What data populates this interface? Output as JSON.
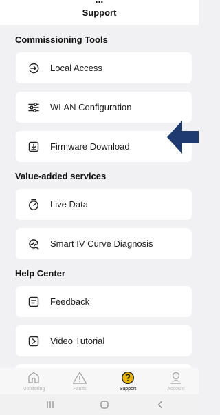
{
  "header": {
    "cut_title": "...",
    "title": "Support"
  },
  "sections": [
    {
      "title": "Commissioning Tools",
      "items": [
        {
          "label": "Local Access",
          "icon": "local-access-icon"
        },
        {
          "label": "WLAN Configuration",
          "icon": "sliders-icon"
        },
        {
          "label": "Firmware Download",
          "icon": "download-icon"
        }
      ]
    },
    {
      "title": "Value-added services",
      "items": [
        {
          "label": "Live Data",
          "icon": "stopwatch-icon"
        },
        {
          "label": "Smart IV Curve Diagnosis",
          "icon": "diagnosis-icon"
        }
      ]
    },
    {
      "title": "Help Center",
      "items": [
        {
          "label": "Feedback",
          "icon": "feedback-icon"
        },
        {
          "label": "Video Tutorial",
          "icon": "video-icon"
        }
      ]
    }
  ],
  "tab_bar": {
    "tabs": [
      {
        "label": "Monitoring",
        "icon": "home-icon",
        "active": false
      },
      {
        "label": "Faults",
        "icon": "warning-icon",
        "active": false
      },
      {
        "label": "Support",
        "icon": "question-icon",
        "active": true
      },
      {
        "label": "Account",
        "icon": "person-icon",
        "active": false
      }
    ]
  },
  "annotation": {
    "icon": "arrow-left-icon",
    "color": "#1f3a6e"
  },
  "colors": {
    "accent": "#e8b400",
    "background": "#f1f1f3",
    "card": "#ffffff"
  }
}
